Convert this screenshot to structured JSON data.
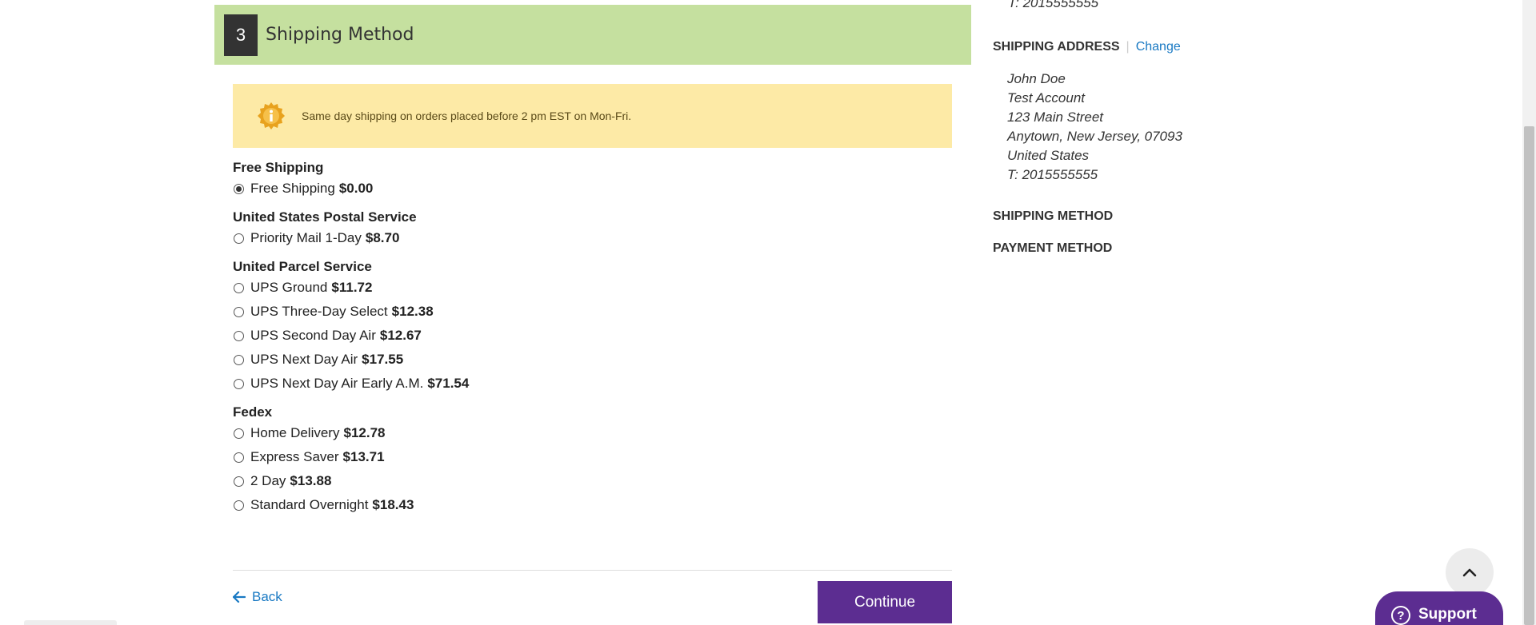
{
  "step": {
    "number": "3",
    "title": "Shipping Method"
  },
  "notice": {
    "text": "Same day shipping on orders placed before 2 pm EST on Mon-Fri.",
    "icon": "info-badge-icon"
  },
  "carriers": [
    {
      "name": "Free Shipping",
      "options": [
        {
          "label": "Free Shipping",
          "price": "$0.00",
          "selected": true
        }
      ]
    },
    {
      "name": "United States Postal Service",
      "options": [
        {
          "label": "Priority Mail 1-Day",
          "price": "$8.70",
          "selected": false
        }
      ]
    },
    {
      "name": "United Parcel Service",
      "options": [
        {
          "label": "UPS Ground",
          "price": "$11.72",
          "selected": false
        },
        {
          "label": "UPS Three-Day Select",
          "price": "$12.38",
          "selected": false
        },
        {
          "label": "UPS Second Day Air",
          "price": "$12.67",
          "selected": false
        },
        {
          "label": "UPS Next Day Air",
          "price": "$17.55",
          "selected": false
        },
        {
          "label": "UPS Next Day Air Early A.M.",
          "price": "$71.54",
          "selected": false
        }
      ]
    },
    {
      "name": "Fedex",
      "options": [
        {
          "label": "Home Delivery",
          "price": "$12.78",
          "selected": false
        },
        {
          "label": "Express Saver",
          "price": "$13.71",
          "selected": false
        },
        {
          "label": "2 Day",
          "price": "$13.88",
          "selected": false
        },
        {
          "label": "Standard Overnight",
          "price": "$18.43",
          "selected": false
        }
      ]
    }
  ],
  "actions": {
    "back_label": "Back",
    "continue_label": "Continue"
  },
  "sidebar": {
    "top_phone": "T: 2015555555",
    "shipping_address_heading": "SHIPPING ADDRESS",
    "change_label": "Change",
    "address_lines": [
      "John Doe",
      "Test Account",
      "123 Main Street",
      "Anytown, New Jersey, 07093",
      "United States",
      "T: 2015555555"
    ],
    "shipping_method_heading": "SHIPPING METHOD",
    "payment_method_heading": "PAYMENT METHOD"
  },
  "support": {
    "label": "Support"
  },
  "colors": {
    "step_header_bg": "#c5e09f",
    "notice_bg": "#fdeaa6",
    "primary": "#5c2d91",
    "link": "#1979c3"
  }
}
